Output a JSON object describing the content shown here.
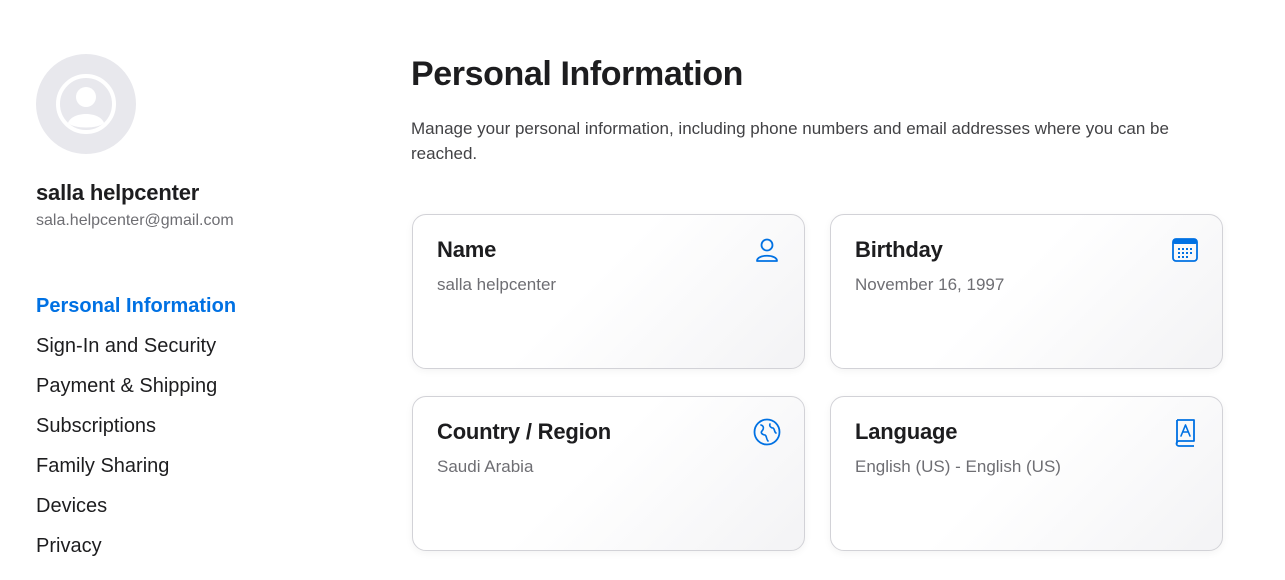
{
  "profile": {
    "name": "salla helpcenter",
    "email": "sala.helpcenter@gmail.com",
    "avatar_icon": "person-circle-icon"
  },
  "nav": {
    "items": [
      {
        "label": "Personal Information",
        "active": true
      },
      {
        "label": "Sign-In and Security",
        "active": false
      },
      {
        "label": "Payment & Shipping",
        "active": false
      },
      {
        "label": "Subscriptions",
        "active": false
      },
      {
        "label": "Family Sharing",
        "active": false
      },
      {
        "label": "Devices",
        "active": false
      },
      {
        "label": "Privacy",
        "active": false
      }
    ]
  },
  "main": {
    "title": "Personal Information",
    "description": "Manage your personal information, including phone numbers and email addresses where you can be reached.",
    "cards": [
      {
        "title": "Name",
        "value": "salla helpcenter",
        "icon": "person-icon"
      },
      {
        "title": "Birthday",
        "value": "November 16, 1997",
        "icon": "calendar-icon"
      },
      {
        "title": "Country / Region",
        "value": "Saudi Arabia",
        "icon": "globe-icon"
      },
      {
        "title": "Language",
        "value": "English (US) - English (US)",
        "icon": "book-icon"
      }
    ]
  },
  "colors": {
    "accent": "#0071e3",
    "text": "#1d1d1f",
    "secondary_text": "#6e6e73",
    "avatar_bg": "#e8e8ed",
    "card_border": "#d2d2d7"
  }
}
